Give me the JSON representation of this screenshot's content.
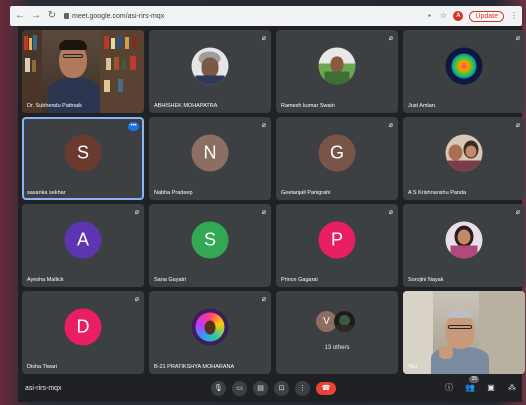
{
  "browser": {
    "url": "meet.google.com/asi-rirs-mqx",
    "update_label": "Update",
    "profile_initial": "A"
  },
  "meeting_code": "asi-rirs-mqx",
  "participant_count": "35",
  "others_count_label": "13 others",
  "tiles": [
    {
      "name": "Dr. Subhendu Pattnaik",
      "kind": "video"
    },
    {
      "name": "ABHISHEK MOHAPATRA",
      "kind": "photo",
      "muted": true
    },
    {
      "name": "Ramesh kumar Swain",
      "kind": "photo",
      "muted": true
    },
    {
      "name": "Just Amlan.",
      "kind": "photo",
      "muted": true
    },
    {
      "name": "sasanka sekhar",
      "kind": "letter",
      "letter": "S",
      "color": "#6b3a2e",
      "speaking": true
    },
    {
      "name": "Nabha Pradeep",
      "kind": "letter",
      "letter": "N",
      "color": "#8d6e63",
      "muted": true
    },
    {
      "name": "Geetanjali Panigrahi",
      "kind": "letter",
      "letter": "G",
      "color": "#795548",
      "muted": true
    },
    {
      "name": "A S Krishnanshu Panda",
      "kind": "photo",
      "muted": true
    },
    {
      "name": "Ayesha Mallick",
      "kind": "letter",
      "letter": "A",
      "color": "#5e35b1",
      "muted": true
    },
    {
      "name": "Sana Gayatri",
      "kind": "letter",
      "letter": "S",
      "color": "#33a853",
      "muted": true
    },
    {
      "name": "Prince Gagarai",
      "kind": "letter",
      "letter": "P",
      "color": "#e91e63",
      "muted": true
    },
    {
      "name": "Sorojini Nayak",
      "kind": "photo",
      "muted": true
    },
    {
      "name": "Disha Tiwari",
      "kind": "letter",
      "letter": "D",
      "color": "#e91e63",
      "muted": true
    },
    {
      "name": "B-21 PRATIKSHYA MOHARANA",
      "kind": "photo",
      "muted": true
    },
    {
      "name": "",
      "kind": "others",
      "letter": "V",
      "color": "#8d6e63"
    },
    {
      "name": "You",
      "kind": "self"
    }
  ],
  "icons": {
    "back": "arrow-left-icon",
    "forward": "arrow-right-icon",
    "reload": "reload-icon",
    "mic": "mic-off-icon"
  }
}
